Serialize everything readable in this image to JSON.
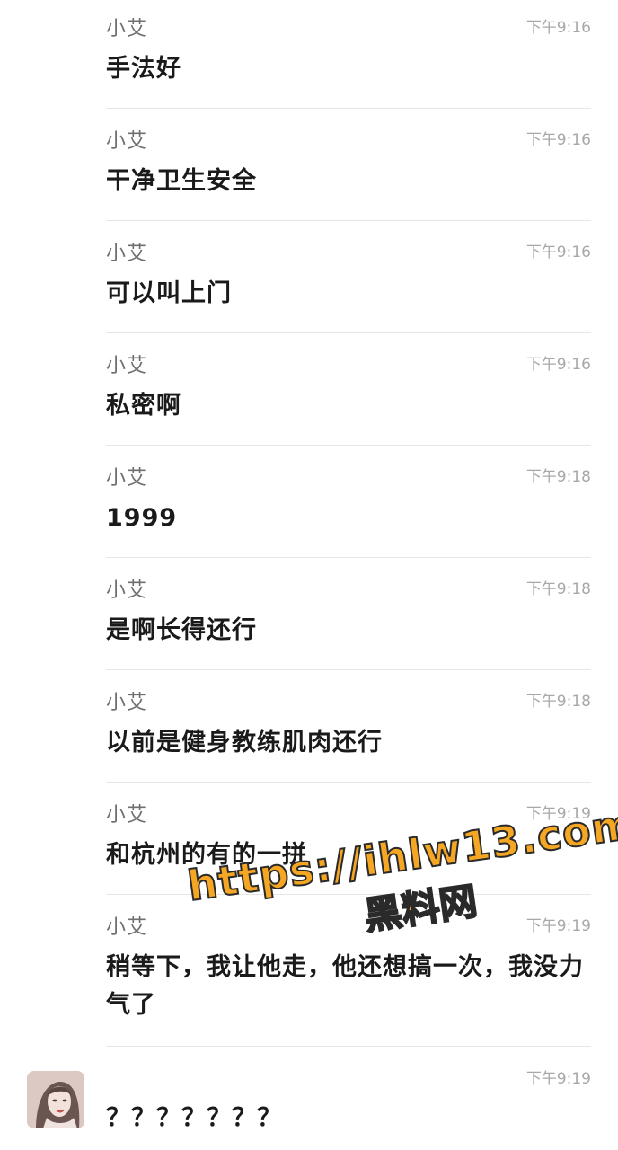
{
  "messages": [
    {
      "sender": "小艾",
      "time": "下午9:16",
      "text": "手法好"
    },
    {
      "sender": "小艾",
      "time": "下午9:16",
      "text": "干净卫生安全"
    },
    {
      "sender": "小艾",
      "time": "下午9:16",
      "text": "可以叫上门"
    },
    {
      "sender": "小艾",
      "time": "下午9:16",
      "text": "私密啊"
    },
    {
      "sender": "小艾",
      "time": "下午9:18",
      "text": "1999"
    },
    {
      "sender": "小艾",
      "time": "下午9:18",
      "text": "是啊长得还行"
    },
    {
      "sender": "小艾",
      "time": "下午9:18",
      "text": "以前是健身教练肌肉还行"
    },
    {
      "sender": "小艾",
      "time": "下午9:19",
      "text": "和杭州的有的一拼"
    },
    {
      "sender": "小艾",
      "time": "下午9:19",
      "text": "稍等下，我让他走，他还想搞一次，我没力气了"
    }
  ],
  "reply": {
    "time": "下午9:19",
    "text": "？？？？？？？",
    "avatar_icon": "avatar-portrait-icon"
  },
  "watermark": {
    "line1": "https://ihlw13.com",
    "line2": "黑料网"
  }
}
